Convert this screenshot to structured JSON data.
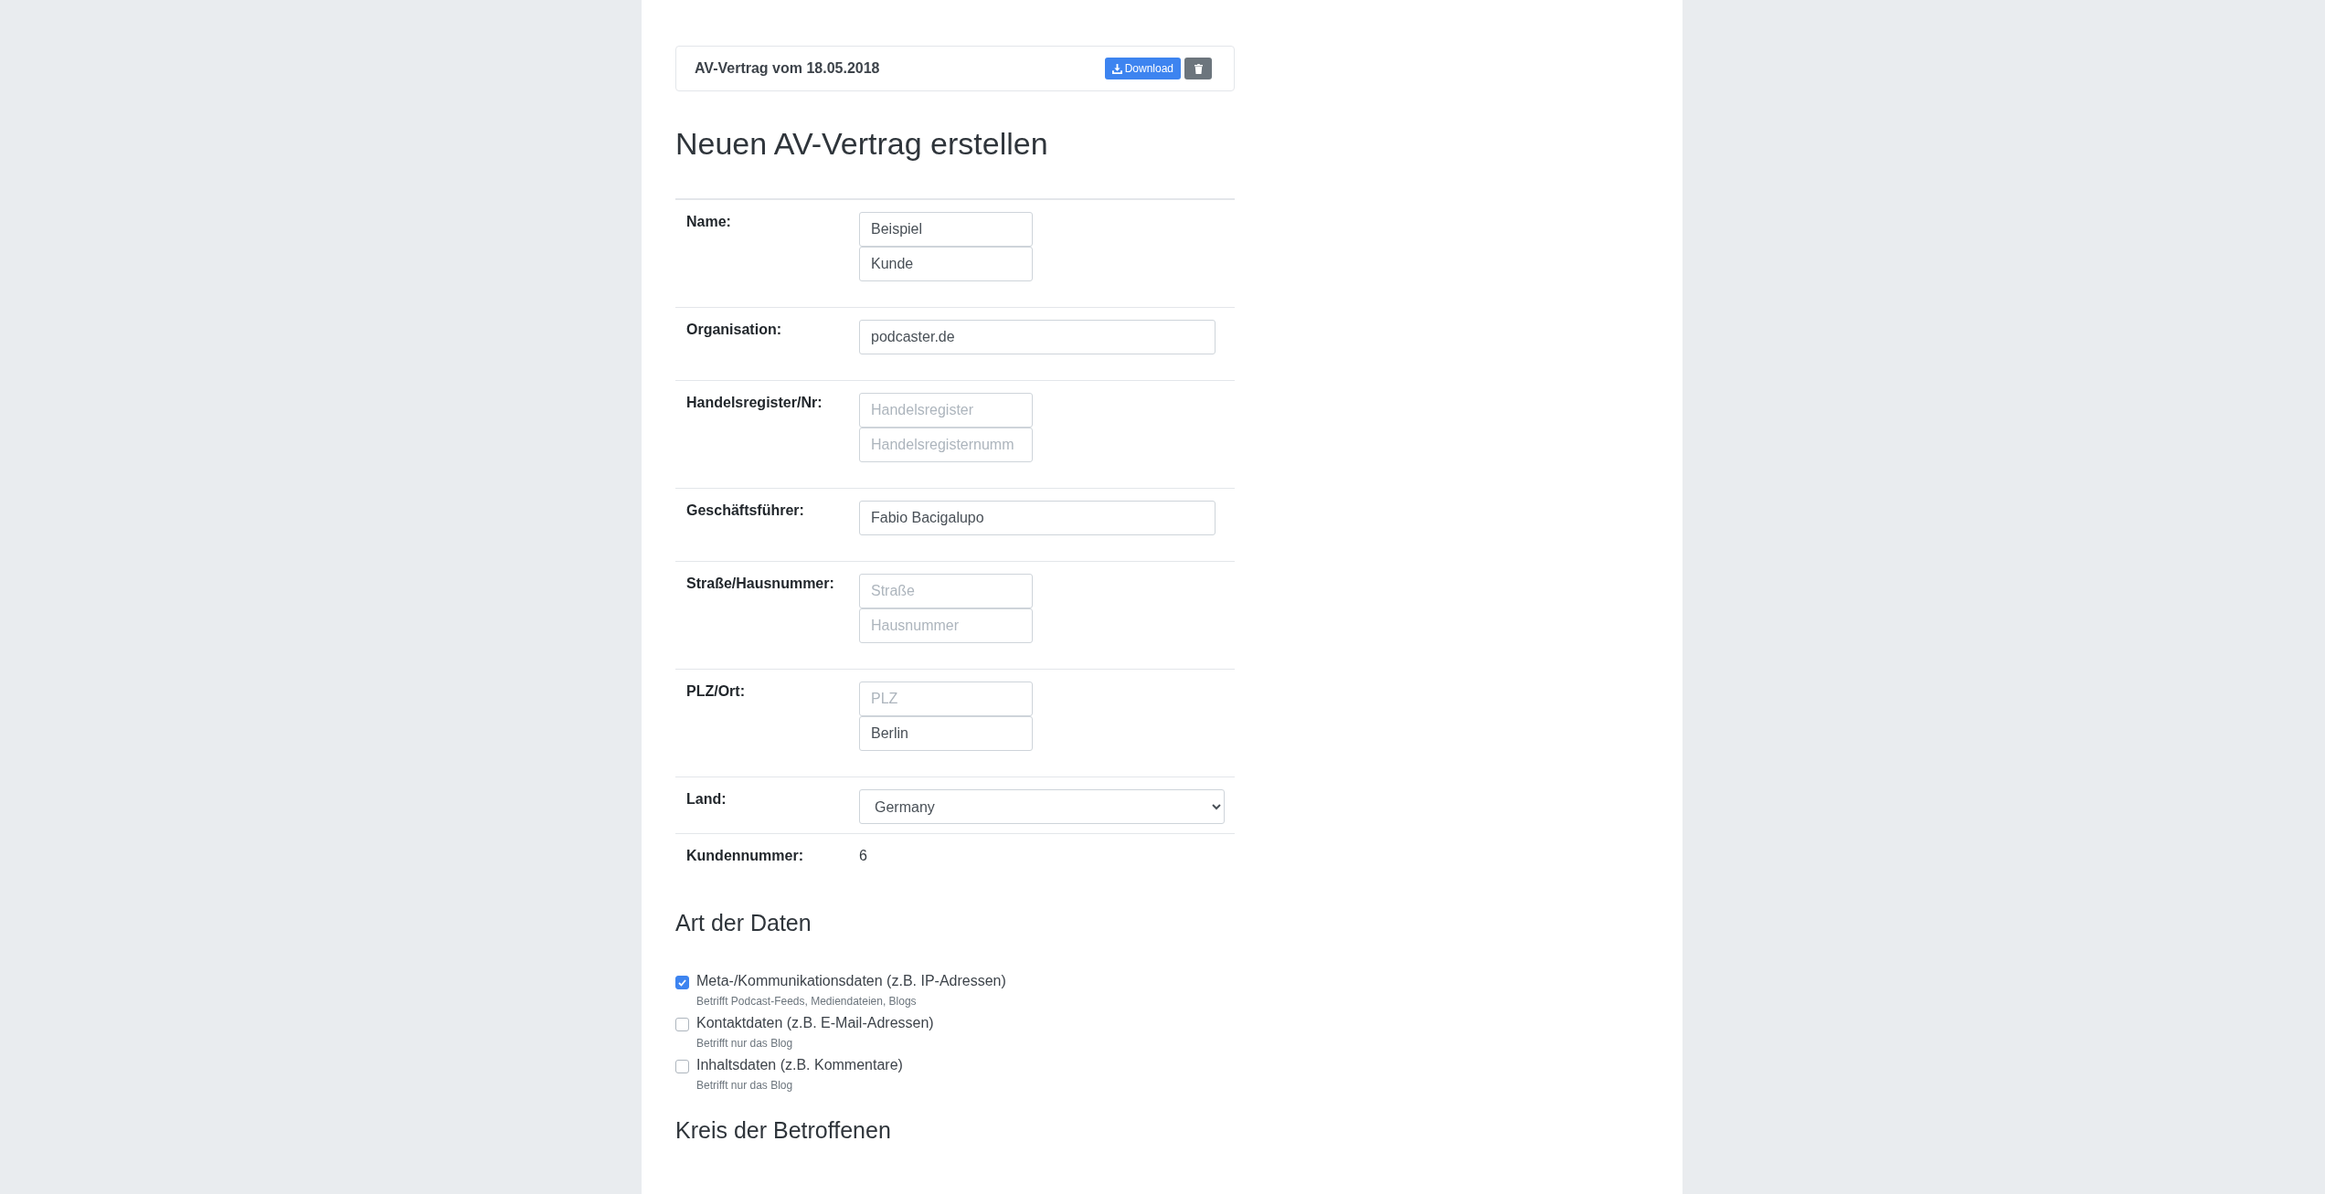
{
  "contract_card": {
    "title": "AV-Vertrag vom 18.05.2018",
    "download_button": "Download"
  },
  "form_title": "Neuen AV-Vertrag erstellen",
  "form_rows": [
    {
      "kind": "inputs",
      "label": "Name:",
      "wide": false,
      "inputs": [
        {
          "value": "Beispiel"
        },
        {
          "value": "Kunde"
        }
      ]
    },
    {
      "kind": "inputs",
      "label": "Organisation:",
      "wide": true,
      "inputs": [
        {
          "value": "podcaster.de"
        }
      ]
    },
    {
      "kind": "inputs",
      "label": "Handelsregister/Nr:",
      "wide": false,
      "inputs": [
        {
          "placeholder": "Handelsregister"
        },
        {
          "placeholder": "Handelsregisternumm"
        }
      ]
    },
    {
      "kind": "inputs",
      "label": "Geschäftsführer:",
      "wide": true,
      "inputs": [
        {
          "value": "Fabio Bacigalupo"
        }
      ]
    },
    {
      "kind": "inputs",
      "label": "Straße/Hausnummer:",
      "wide": false,
      "inputs": [
        {
          "placeholder": "Straße"
        },
        {
          "placeholder": "Hausnummer"
        }
      ]
    },
    {
      "kind": "inputs",
      "label": "PLZ/Ort:",
      "wide": false,
      "inputs": [
        {
          "placeholder": "PLZ"
        },
        {
          "value": "Berlin"
        }
      ]
    },
    {
      "kind": "select",
      "label": "Land:",
      "value": "Germany"
    },
    {
      "kind": "text",
      "label": "Kundennummer:",
      "value": "6"
    }
  ],
  "data_types": {
    "heading": "Art der Daten",
    "options": [
      {
        "label": "Meta-/Kommunikationsdaten (z.B. IP-Adressen)",
        "hint": "Betrifft Podcast-Feeds, Mediendateien, Blogs",
        "checked": true
      },
      {
        "label": "Kontaktdaten (z.B. E-Mail-Adressen)",
        "hint": "Betrifft nur das Blog",
        "checked": false
      },
      {
        "label": "Inhaltsdaten (z.B. Kommentare)",
        "hint": "Betrifft nur das Blog",
        "checked": false
      }
    ]
  },
  "next_heading": "Kreis der Betroffenen"
}
